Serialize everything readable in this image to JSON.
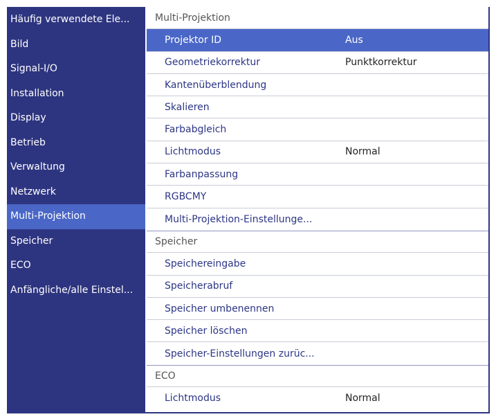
{
  "sidebar": {
    "items": [
      {
        "label": "Häufig verwendete Ele..."
      },
      {
        "label": "Bild"
      },
      {
        "label": "Signal-I/O"
      },
      {
        "label": "Installation"
      },
      {
        "label": "Display"
      },
      {
        "label": "Betrieb"
      },
      {
        "label": "Verwaltung"
      },
      {
        "label": "Netzwerk"
      },
      {
        "label": "Multi-Projektion",
        "selected": true
      },
      {
        "label": "Speicher"
      },
      {
        "label": "ECO"
      },
      {
        "label": "Anfängliche/alle Einstel..."
      }
    ]
  },
  "main": {
    "sections": [
      {
        "title": "Multi-Projektion",
        "items": [
          {
            "label": "Projektor ID",
            "value": "Aus",
            "selected": true
          },
          {
            "label": "Geometriekorrektur",
            "value": "Punktkorrektur"
          },
          {
            "label": "Kantenüberblendung",
            "value": ""
          },
          {
            "label": "Skalieren",
            "value": ""
          },
          {
            "label": "Farbabgleich",
            "value": ""
          },
          {
            "label": "Lichtmodus",
            "value": "Normal"
          },
          {
            "label": "Farbanpassung",
            "value": ""
          },
          {
            "label": "RGBCMY",
            "value": ""
          },
          {
            "label": "Multi-Projektion-Einstellunge...",
            "value": ""
          }
        ]
      },
      {
        "title": "Speicher",
        "items": [
          {
            "label": "Speichereingabe",
            "value": ""
          },
          {
            "label": "Speicherabruf",
            "value": ""
          },
          {
            "label": "Speicher umbenennen",
            "value": ""
          },
          {
            "label": "Speicher löschen",
            "value": ""
          },
          {
            "label": "Speicher-Einstellungen zurüc...",
            "value": ""
          }
        ]
      },
      {
        "title": "ECO",
        "items": [
          {
            "label": "Lichtmodus",
            "value": "Normal"
          }
        ]
      }
    ]
  },
  "colors": {
    "sidebar_bg": "#2e3580",
    "selected_bg": "#4a67c7",
    "item_text": "#2c3585",
    "header_text": "#555555"
  }
}
